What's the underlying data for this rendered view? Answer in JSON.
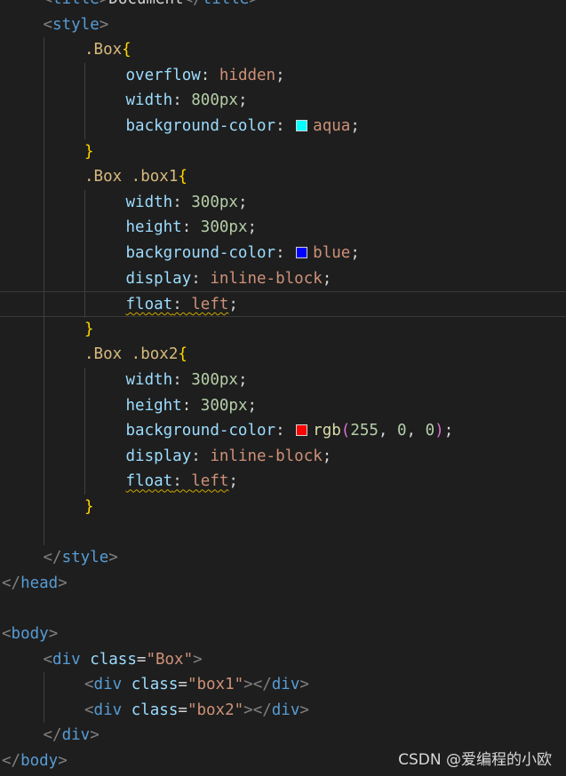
{
  "editor": {
    "theme": "dark",
    "lines": [
      {
        "indent": 1,
        "current": false,
        "tokens": [
          {
            "t": "<",
            "c": "punct"
          },
          {
            "t": "title",
            "c": "tag"
          },
          {
            "t": ">",
            "c": "punct"
          },
          {
            "t": "Document",
            "c": "text"
          },
          {
            "t": "</",
            "c": "punct"
          },
          {
            "t": "title",
            "c": "tag"
          },
          {
            "t": ">",
            "c": "punct"
          }
        ]
      },
      {
        "indent": 1,
        "current": false,
        "tokens": [
          {
            "t": "<",
            "c": "punct"
          },
          {
            "t": "style",
            "c": "tag"
          },
          {
            "t": ">",
            "c": "punct"
          }
        ]
      },
      {
        "indent": 2,
        "current": false,
        "tokens": [
          {
            "t": ".Box",
            "c": "sel"
          },
          {
            "t": "{",
            "c": "brace"
          }
        ]
      },
      {
        "indent": 3,
        "current": false,
        "tokens": [
          {
            "t": "overflow",
            "c": "prop"
          },
          {
            "t": ": ",
            "c": "colon"
          },
          {
            "t": "hidden",
            "c": "val"
          },
          {
            "t": ";",
            "c": "colon"
          }
        ]
      },
      {
        "indent": 3,
        "current": false,
        "tokens": [
          {
            "t": "width",
            "c": "prop"
          },
          {
            "t": ": ",
            "c": "colon"
          },
          {
            "t": "800px",
            "c": "num"
          },
          {
            "t": ";",
            "c": "colon"
          }
        ]
      },
      {
        "indent": 3,
        "current": false,
        "tokens": [
          {
            "t": "background-color",
            "c": "prop"
          },
          {
            "t": ": ",
            "c": "colon"
          },
          {
            "swatch": "#00ffff"
          },
          {
            "t": "aqua",
            "c": "val"
          },
          {
            "t": ";",
            "c": "colon"
          }
        ]
      },
      {
        "indent": 2,
        "current": false,
        "tokens": [
          {
            "t": "}",
            "c": "brace"
          }
        ]
      },
      {
        "indent": 2,
        "current": false,
        "tokens": [
          {
            "t": ".Box .box1",
            "c": "sel"
          },
          {
            "t": "{",
            "c": "brace"
          }
        ]
      },
      {
        "indent": 3,
        "current": false,
        "tokens": [
          {
            "t": "width",
            "c": "prop"
          },
          {
            "t": ": ",
            "c": "colon"
          },
          {
            "t": "300px",
            "c": "num"
          },
          {
            "t": ";",
            "c": "colon"
          }
        ]
      },
      {
        "indent": 3,
        "current": false,
        "tokens": [
          {
            "t": "height",
            "c": "prop"
          },
          {
            "t": ": ",
            "c": "colon"
          },
          {
            "t": "300px",
            "c": "num"
          },
          {
            "t": ";",
            "c": "colon"
          }
        ]
      },
      {
        "indent": 3,
        "current": false,
        "tokens": [
          {
            "t": "background-color",
            "c": "prop"
          },
          {
            "t": ": ",
            "c": "colon"
          },
          {
            "swatch": "#0000ff"
          },
          {
            "t": "blue",
            "c": "val"
          },
          {
            "t": ";",
            "c": "colon"
          }
        ]
      },
      {
        "indent": 3,
        "current": false,
        "tokens": [
          {
            "t": "display",
            "c": "prop"
          },
          {
            "t": ": ",
            "c": "colon"
          },
          {
            "t": "inline-block",
            "c": "val"
          },
          {
            "t": ";",
            "c": "colon"
          }
        ]
      },
      {
        "indent": 3,
        "current": true,
        "tokens": [
          {
            "t": "float",
            "c": "prop",
            "warn": true
          },
          {
            "t": ": ",
            "c": "colon",
            "warn": true
          },
          {
            "t": "left",
            "c": "val",
            "warn": true
          },
          {
            "t": ";",
            "c": "colon"
          }
        ]
      },
      {
        "indent": 2,
        "current": false,
        "tokens": [
          {
            "t": "}",
            "c": "brace"
          }
        ]
      },
      {
        "indent": 2,
        "current": false,
        "tokens": [
          {
            "t": ".Box .box2",
            "c": "sel"
          },
          {
            "t": "{",
            "c": "brace"
          }
        ]
      },
      {
        "indent": 3,
        "current": false,
        "tokens": [
          {
            "t": "width",
            "c": "prop"
          },
          {
            "t": ": ",
            "c": "colon"
          },
          {
            "t": "300px",
            "c": "num"
          },
          {
            "t": ";",
            "c": "colon"
          }
        ]
      },
      {
        "indent": 3,
        "current": false,
        "tokens": [
          {
            "t": "height",
            "c": "prop"
          },
          {
            "t": ": ",
            "c": "colon"
          },
          {
            "t": "300px",
            "c": "num"
          },
          {
            "t": ";",
            "c": "colon"
          }
        ]
      },
      {
        "indent": 3,
        "current": false,
        "tokens": [
          {
            "t": "background-color",
            "c": "prop"
          },
          {
            "t": ": ",
            "c": "colon"
          },
          {
            "swatch": "#ff0000"
          },
          {
            "t": "rgb",
            "c": "func"
          },
          {
            "t": "(",
            "c": "paren"
          },
          {
            "t": "255",
            "c": "num"
          },
          {
            "t": ", ",
            "c": "colon"
          },
          {
            "t": "0",
            "c": "num"
          },
          {
            "t": ", ",
            "c": "colon"
          },
          {
            "t": "0",
            "c": "num"
          },
          {
            "t": ")",
            "c": "paren"
          },
          {
            "t": ";",
            "c": "colon"
          }
        ]
      },
      {
        "indent": 3,
        "current": false,
        "tokens": [
          {
            "t": "display",
            "c": "prop"
          },
          {
            "t": ": ",
            "c": "colon"
          },
          {
            "t": "inline-block",
            "c": "val"
          },
          {
            "t": ";",
            "c": "colon"
          }
        ]
      },
      {
        "indent": 3,
        "current": false,
        "tokens": [
          {
            "t": "float",
            "c": "prop",
            "warn": true
          },
          {
            "t": ": ",
            "c": "colon",
            "warn": true
          },
          {
            "t": "left",
            "c": "val",
            "warn": true
          },
          {
            "t": ";",
            "c": "colon"
          }
        ]
      },
      {
        "indent": 2,
        "current": false,
        "tokens": [
          {
            "t": "}",
            "c": "brace"
          }
        ]
      },
      {
        "indent": 2,
        "current": false,
        "tokens": []
      },
      {
        "indent": 1,
        "current": false,
        "tokens": [
          {
            "t": "</",
            "c": "punct"
          },
          {
            "t": "style",
            "c": "tag"
          },
          {
            "t": ">",
            "c": "punct"
          }
        ]
      },
      {
        "indent": 0,
        "current": false,
        "tokens": [
          {
            "t": "</",
            "c": "punct"
          },
          {
            "t": "head",
            "c": "tag"
          },
          {
            "t": ">",
            "c": "punct"
          }
        ]
      },
      {
        "indent": 0,
        "current": false,
        "tokens": []
      },
      {
        "indent": 0,
        "current": false,
        "tokens": [
          {
            "t": "<",
            "c": "punct"
          },
          {
            "t": "body",
            "c": "tag"
          },
          {
            "t": ">",
            "c": "punct"
          }
        ]
      },
      {
        "indent": 1,
        "current": false,
        "tokens": [
          {
            "t": "<",
            "c": "punct"
          },
          {
            "t": "div",
            "c": "tag"
          },
          {
            "t": " ",
            "c": "text"
          },
          {
            "t": "class",
            "c": "attr"
          },
          {
            "t": "=",
            "c": "eq"
          },
          {
            "t": "\"Box\"",
            "c": "str"
          },
          {
            "t": ">",
            "c": "punct"
          }
        ]
      },
      {
        "indent": 2,
        "current": false,
        "tokens": [
          {
            "t": "<",
            "c": "punct"
          },
          {
            "t": "div",
            "c": "tag"
          },
          {
            "t": " ",
            "c": "text"
          },
          {
            "t": "class",
            "c": "attr"
          },
          {
            "t": "=",
            "c": "eq"
          },
          {
            "t": "\"box1\"",
            "c": "str"
          },
          {
            "t": "></",
            "c": "punct"
          },
          {
            "t": "div",
            "c": "tag"
          },
          {
            "t": ">",
            "c": "punct"
          }
        ]
      },
      {
        "indent": 2,
        "current": false,
        "tokens": [
          {
            "t": "<",
            "c": "punct"
          },
          {
            "t": "div",
            "c": "tag"
          },
          {
            "t": " ",
            "c": "text"
          },
          {
            "t": "class",
            "c": "attr"
          },
          {
            "t": "=",
            "c": "eq"
          },
          {
            "t": "\"box2\"",
            "c": "str"
          },
          {
            "t": "></",
            "c": "punct"
          },
          {
            "t": "div",
            "c": "tag"
          },
          {
            "t": ">",
            "c": "punct"
          }
        ]
      },
      {
        "indent": 1,
        "current": false,
        "tokens": [
          {
            "t": "</",
            "c": "punct"
          },
          {
            "t": "div",
            "c": "tag"
          },
          {
            "t": ">",
            "c": "punct"
          }
        ]
      },
      {
        "indent": 0,
        "current": false,
        "tokens": [
          {
            "t": "</",
            "c": "punct"
          },
          {
            "t": "body",
            "c": "tag"
          },
          {
            "t": ">",
            "c": "punct"
          }
        ]
      }
    ]
  },
  "watermark": "CSDN @爱编程的小欧"
}
